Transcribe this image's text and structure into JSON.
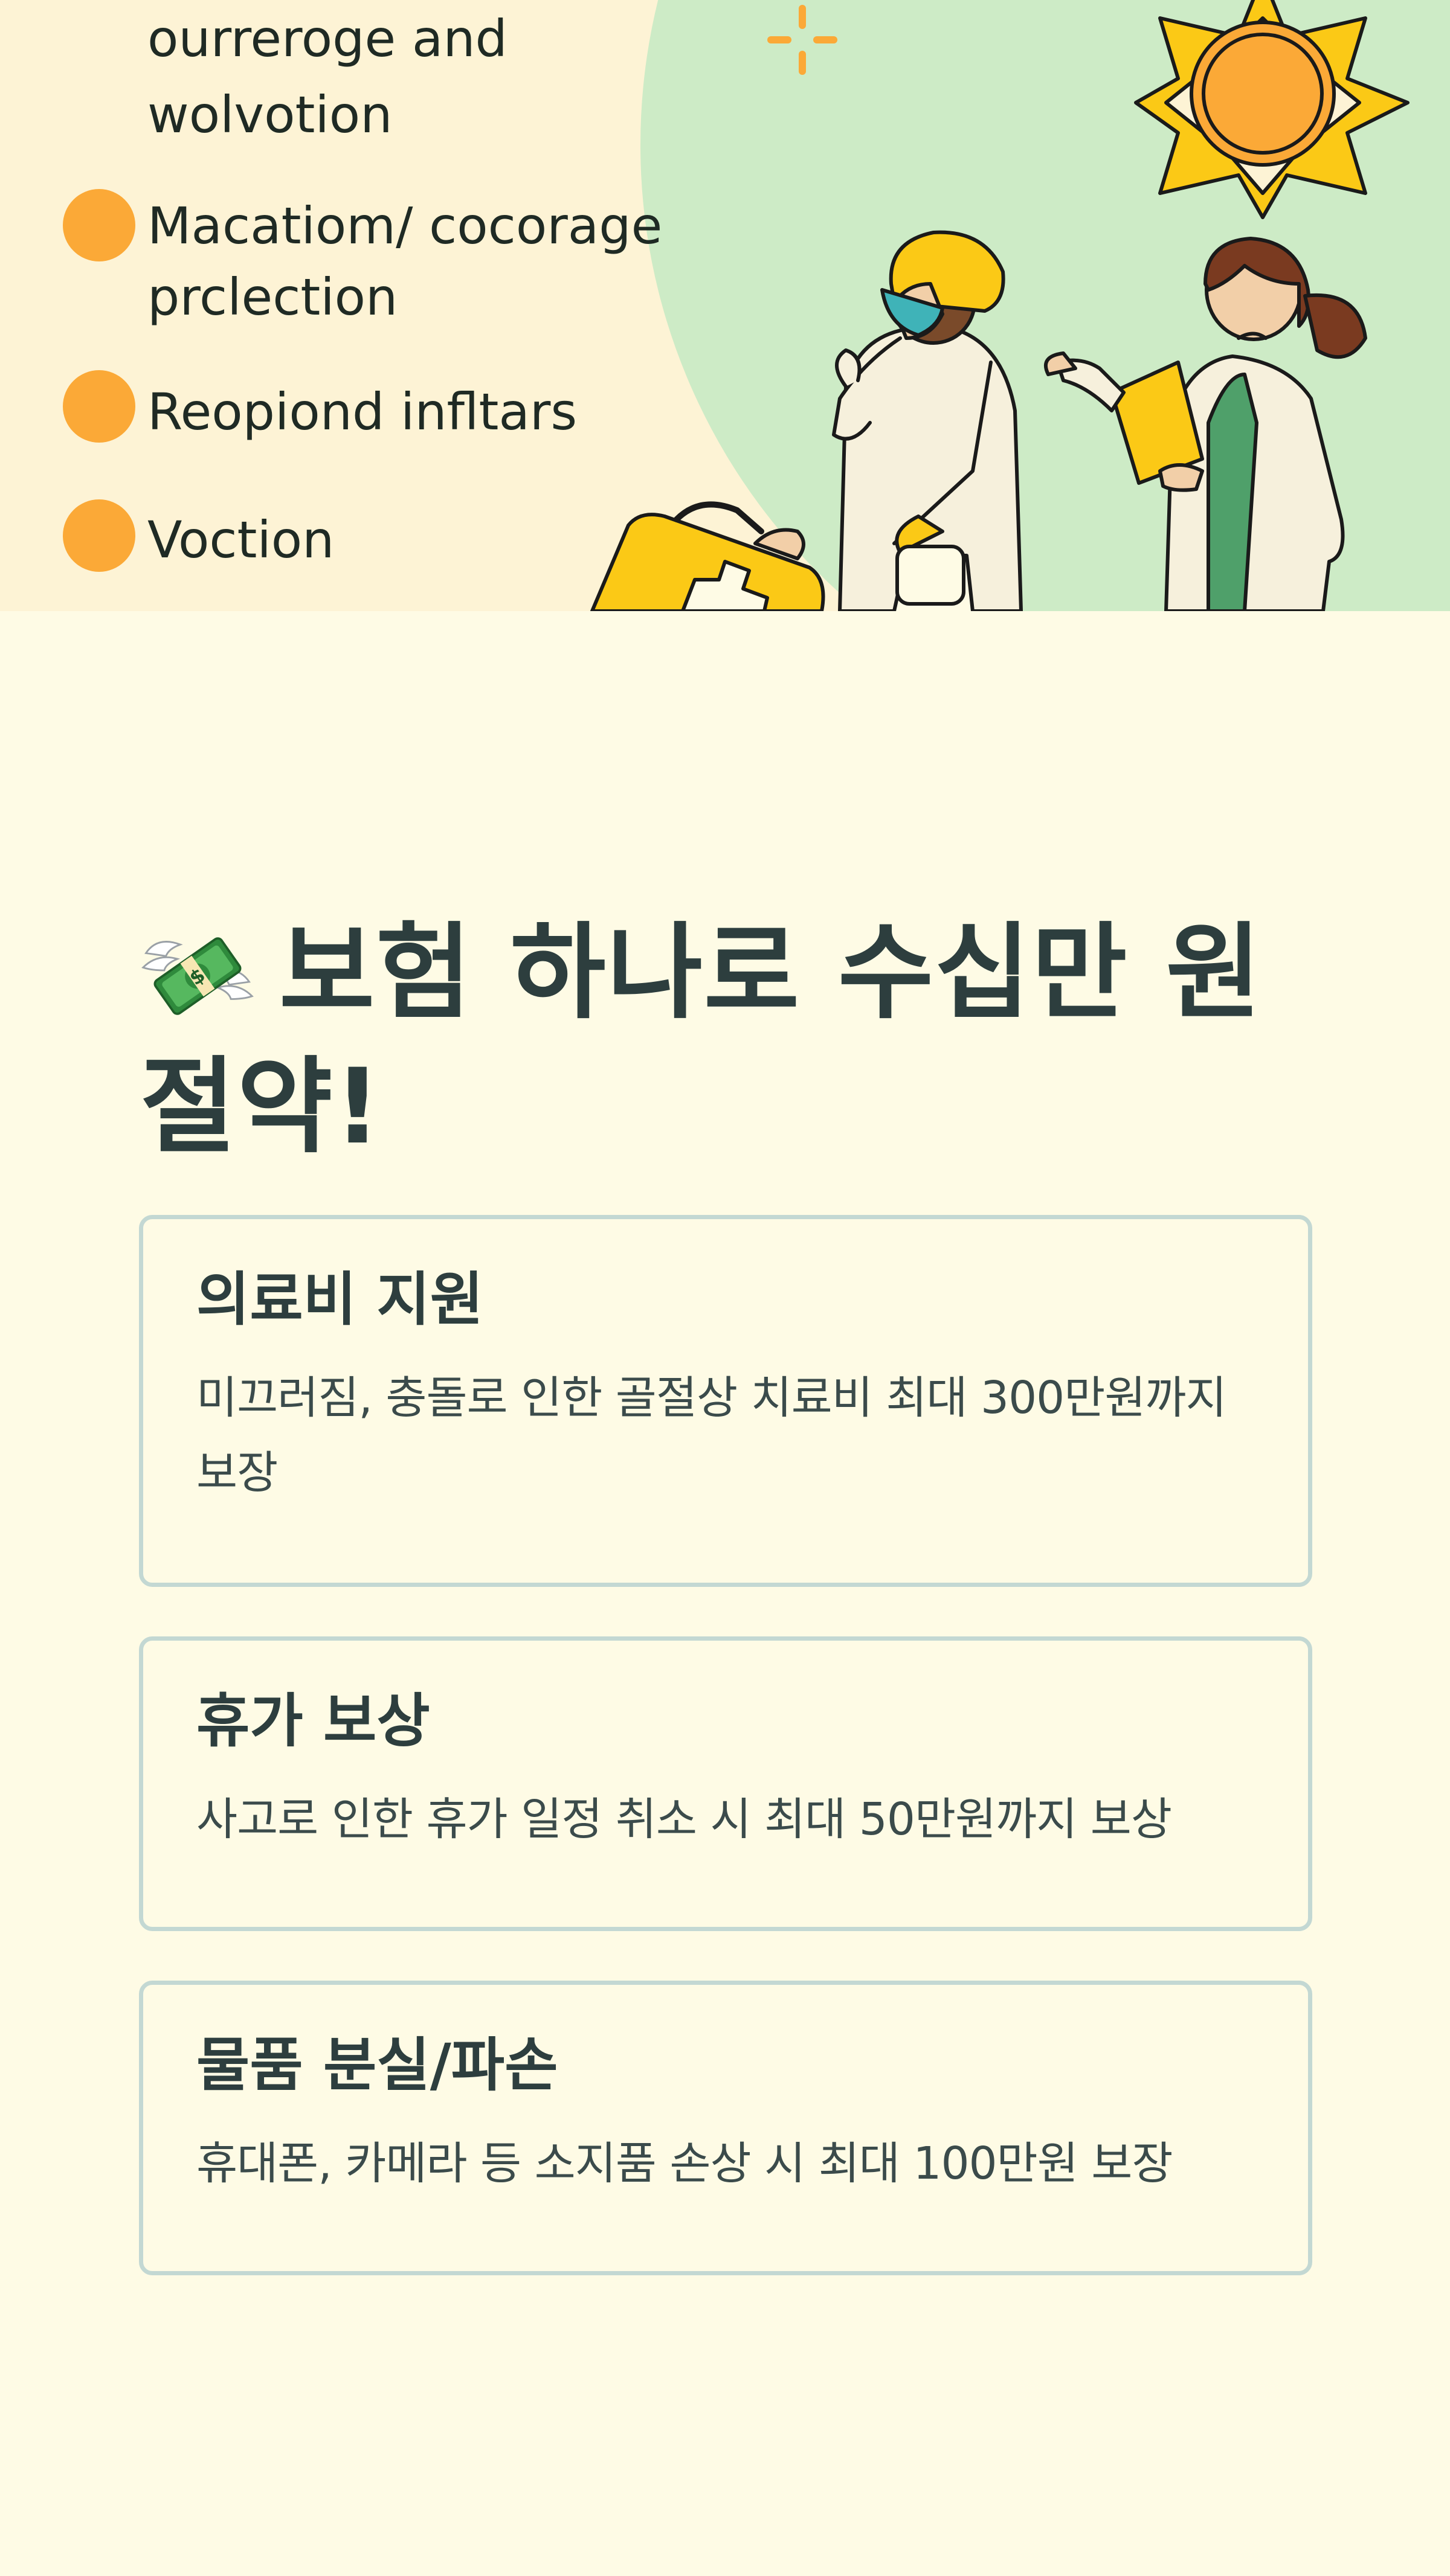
{
  "hero": {
    "lines": [
      "ourreroge and",
      "wolvotion",
      "Macatiom/ cocorage",
      "prclection",
      "Reopiond infltars",
      "Voction"
    ],
    "illustration": "two-doctors-with-first-aid-kit-and-sun-illustration"
  },
  "main": {
    "title": "보험 하나로 수십만 원 절약!",
    "title_icon": "money-with-wings-icon",
    "cards": [
      {
        "title": "의료비 지원",
        "description": "미끄러짐, 충돌로 인한 골절상 치료비 최대 300만원까지 보장"
      },
      {
        "title": "휴가 보상",
        "description": "사고로 인한 휴가 일정 취소 시 최대 50만원까지 보상"
      },
      {
        "title": "물품 분실/파손",
        "description": "휴대폰, 카메라 등 소지품 손상 시 최대 100만원 보장"
      }
    ]
  },
  "colors": {
    "page_background": "#fefbe5",
    "hero_background": "#fdf3d5",
    "hero_circle": "#cdebc6",
    "bullet": "#fba937",
    "text": "#2d3e3e",
    "card_border": "#c3d8d3",
    "sun_yellow": "#fbc916",
    "sun_orange": "#fba937"
  }
}
